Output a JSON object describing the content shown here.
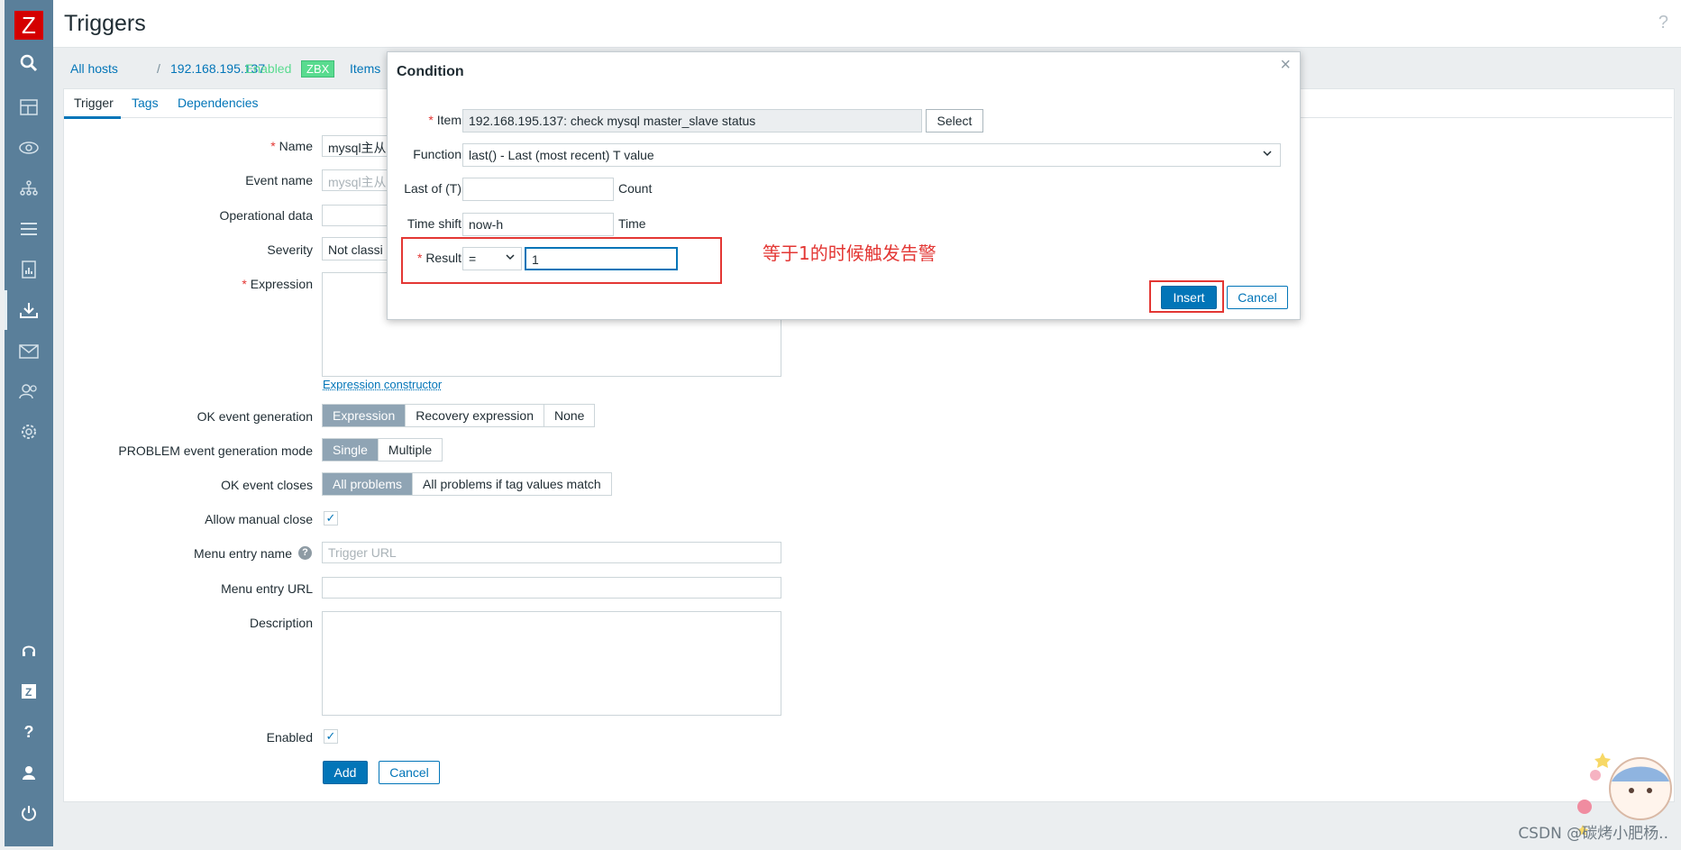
{
  "app": {
    "logo_letter": "Z",
    "title": "Triggers",
    "help": "?"
  },
  "sidebar": {
    "icons": [
      "search-icon",
      "dashboard-icon",
      "monitoring-eye-icon",
      "inventory-tree-icon",
      "reports-list-icon",
      "reports-chart-icon",
      "data-collection-icon",
      "alerts-mail-icon",
      "users-icon",
      "administration-gear-icon",
      "support-headset-icon",
      "zabbix-share-icon",
      "help-icon",
      "user-profile-icon",
      "sign-out-icon"
    ]
  },
  "breadcrumb": {
    "all_hosts": "All hosts",
    "sep": "/",
    "host": "192.168.195.137",
    "enabled": "Enabled",
    "zbx": "ZBX",
    "items": "Items"
  },
  "tabs": [
    "Trigger",
    "Tags",
    "Dependencies"
  ],
  "form": {
    "name_label": "Name",
    "name_value": "mysql主从",
    "event_name_label": "Event name",
    "event_name_placeholder": "mysql主从",
    "opdata_label": "Operational data",
    "severity_label": "Severity",
    "severity_value": "Not classi",
    "expression_label": "Expression",
    "expression_constructor": "Expression constructor",
    "ok_event_gen_label": "OK event generation",
    "ok_event_gen_options": [
      "Expression",
      "Recovery expression",
      "None"
    ],
    "problem_mode_label": "PROBLEM event generation mode",
    "problem_mode_options": [
      "Single",
      "Multiple"
    ],
    "ok_closes_label": "OK event closes",
    "ok_closes_options": [
      "All problems",
      "All problems if tag values match"
    ],
    "manual_close_label": "Allow manual close",
    "menu_entry_name_label": "Menu entry name",
    "menu_entry_name_placeholder": "Trigger URL",
    "menu_entry_url_label": "Menu entry URL",
    "description_label": "Description",
    "enabled_label": "Enabled",
    "add": "Add",
    "cancel": "Cancel"
  },
  "dialog": {
    "title": "Condition",
    "close": "×",
    "item_label": "Item",
    "item_value": "192.168.195.137: check mysql master_slave status",
    "select": "Select",
    "function_label": "Function",
    "function_value": "last() - Last (most recent) T value",
    "last_of_label": "Last of (T)",
    "count": "Count",
    "time_shift_label": "Time shift",
    "time_shift_placeholder": "now-h",
    "time": "Time",
    "result_label": "Result",
    "result_operator": "=",
    "result_value": "1",
    "insert": "Insert",
    "cancel": "Cancel"
  },
  "annotation": "等于1的时候触发告警",
  "watermark": "CSDN @碳烤小肥杨.."
}
